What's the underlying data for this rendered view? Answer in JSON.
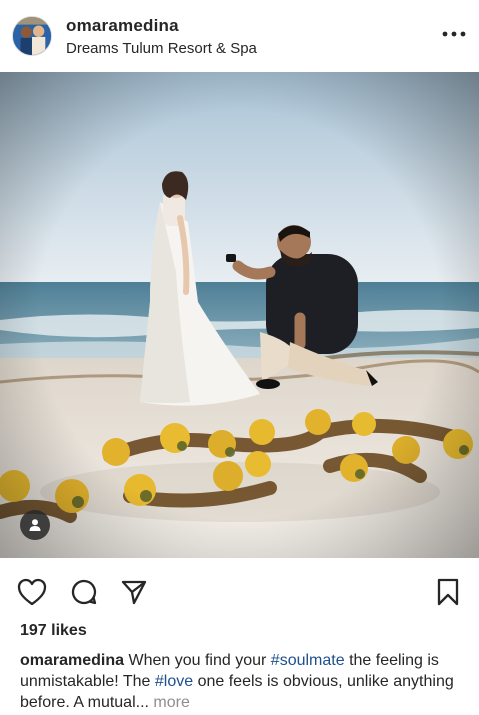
{
  "post": {
    "username": "omaramedina",
    "location": "Dreams Tulum Resort & Spa",
    "more_icon": "more-horizontal-icon",
    "likes": "197 likes",
    "caption": {
      "username": "omaramedina",
      "text_1": "When you find your ",
      "hashtag_1": "#soulmate",
      "text_2": " the feeling is unmistakable! The ",
      "hashtag_2": "#love",
      "text_3": " one feels is obvious, unlike anything before. A mutual...",
      "more_label": " more"
    },
    "actions": {
      "like_icon": "heart-icon",
      "comment_icon": "comment-icon",
      "share_icon": "share-icon",
      "save_icon": "bookmark-icon"
    },
    "hashtag_color": "#1f4f8e",
    "more_color": "#8e8e8e"
  }
}
